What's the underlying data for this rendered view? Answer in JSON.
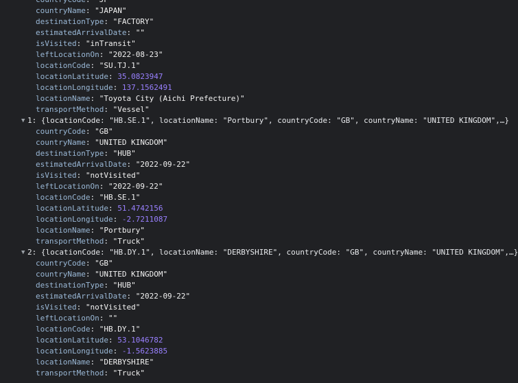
{
  "blocks": [
    {
      "header": null,
      "props": [
        {
          "key": "countryCode",
          "value": "\"JP\"",
          "type": "str"
        },
        {
          "key": "countryName",
          "value": "\"JAPAN\"",
          "type": "str"
        },
        {
          "key": "destinationType",
          "value": "\"FACTORY\"",
          "type": "str"
        },
        {
          "key": "estimatedArrivalDate",
          "value": "\"\"",
          "type": "str"
        },
        {
          "key": "isVisited",
          "value": "\"inTransit\"",
          "type": "str"
        },
        {
          "key": "leftLocationOn",
          "value": "\"2022-08-23\"",
          "type": "str"
        },
        {
          "key": "locationCode",
          "value": "\"SU.TJ.1\"",
          "type": "str"
        },
        {
          "key": "locationLatitude",
          "value": "35.0823947",
          "type": "num"
        },
        {
          "key": "locationLongitude",
          "value": "137.1562491",
          "type": "num"
        },
        {
          "key": "locationName",
          "value": "\"Toyota City (Aichi Prefecture)\"",
          "type": "str"
        },
        {
          "key": "transportMethod",
          "value": "\"Vessel\"",
          "type": "str"
        }
      ]
    },
    {
      "header": {
        "toggle": "▼",
        "index": "1:",
        "summary": "{locationCode: \"HB.SE.1\", locationName: \"Portbury\", countryCode: \"GB\", countryName: \"UNITED KINGDOM\",…}"
      },
      "props": [
        {
          "key": "countryCode",
          "value": "\"GB\"",
          "type": "str"
        },
        {
          "key": "countryName",
          "value": "\"UNITED KINGDOM\"",
          "type": "str"
        },
        {
          "key": "destinationType",
          "value": "\"HUB\"",
          "type": "str"
        },
        {
          "key": "estimatedArrivalDate",
          "value": "\"2022-09-22\"",
          "type": "str"
        },
        {
          "key": "isVisited",
          "value": "\"notVisited\"",
          "type": "str"
        },
        {
          "key": "leftLocationOn",
          "value": "\"2022-09-22\"",
          "type": "str"
        },
        {
          "key": "locationCode",
          "value": "\"HB.SE.1\"",
          "type": "str"
        },
        {
          "key": "locationLatitude",
          "value": "51.4742156",
          "type": "num"
        },
        {
          "key": "locationLongitude",
          "value": "-2.7211087",
          "type": "num"
        },
        {
          "key": "locationName",
          "value": "\"Portbury\"",
          "type": "str"
        },
        {
          "key": "transportMethod",
          "value": "\"Truck\"",
          "type": "str"
        }
      ]
    },
    {
      "header": {
        "toggle": "▼",
        "index": "2:",
        "summary": "{locationCode: \"HB.DY.1\", locationName: \"DERBYSHIRE\", countryCode: \"GB\", countryName: \"UNITED KINGDOM\",…}"
      },
      "props": [
        {
          "key": "countryCode",
          "value": "\"GB\"",
          "type": "str"
        },
        {
          "key": "countryName",
          "value": "\"UNITED KINGDOM\"",
          "type": "str"
        },
        {
          "key": "destinationType",
          "value": "\"HUB\"",
          "type": "str"
        },
        {
          "key": "estimatedArrivalDate",
          "value": "\"2022-09-22\"",
          "type": "str"
        },
        {
          "key": "isVisited",
          "value": "\"notVisited\"",
          "type": "str"
        },
        {
          "key": "leftLocationOn",
          "value": "\"\"",
          "type": "str"
        },
        {
          "key": "locationCode",
          "value": "\"HB.DY.1\"",
          "type": "str"
        },
        {
          "key": "locationLatitude",
          "value": "53.1046782",
          "type": "num"
        },
        {
          "key": "locationLongitude",
          "value": "-1.5623885",
          "type": "num"
        },
        {
          "key": "locationName",
          "value": "\"DERBYSHIRE\"",
          "type": "str"
        },
        {
          "key": "transportMethod",
          "value": "\"Truck\"",
          "type": "str"
        }
      ]
    }
  ],
  "colors": {
    "background": "#202124",
    "key": "#9ab8d6",
    "string": "#f2f2f2",
    "number": "#9980ff",
    "toggle": "#9aa0a6"
  }
}
